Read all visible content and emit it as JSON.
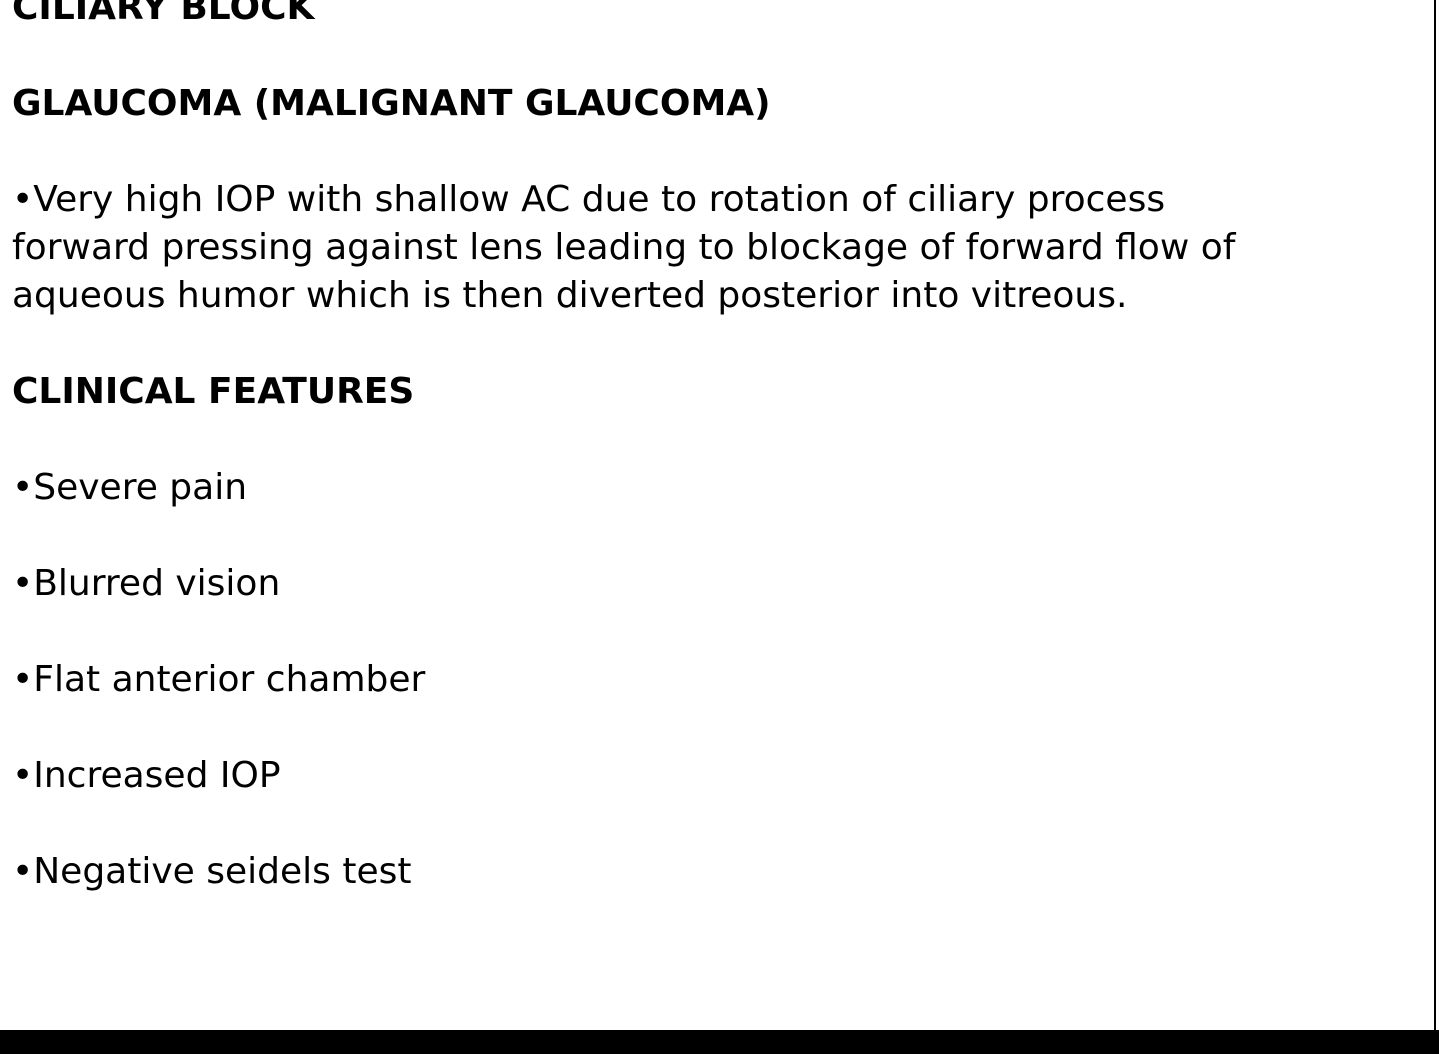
{
  "headings": {
    "line1": "CILIARY BLOCK",
    "line2": "GLAUCOMA (MALIGNANT GLAUCOMA)",
    "clinical": "CLINICAL FEATURES"
  },
  "description": "•Very high IOP with shallow AC due to rotation of ciliary process forward pressing against lens leading to blockage of forward flow of aqueous humor which is then diverted posterior into vitreous.",
  "features": [
    "•Severe pain",
    "•Blurred vision",
    "•Flat anterior chamber",
    "•Increased IOP",
    "•Negative seidels test"
  ]
}
